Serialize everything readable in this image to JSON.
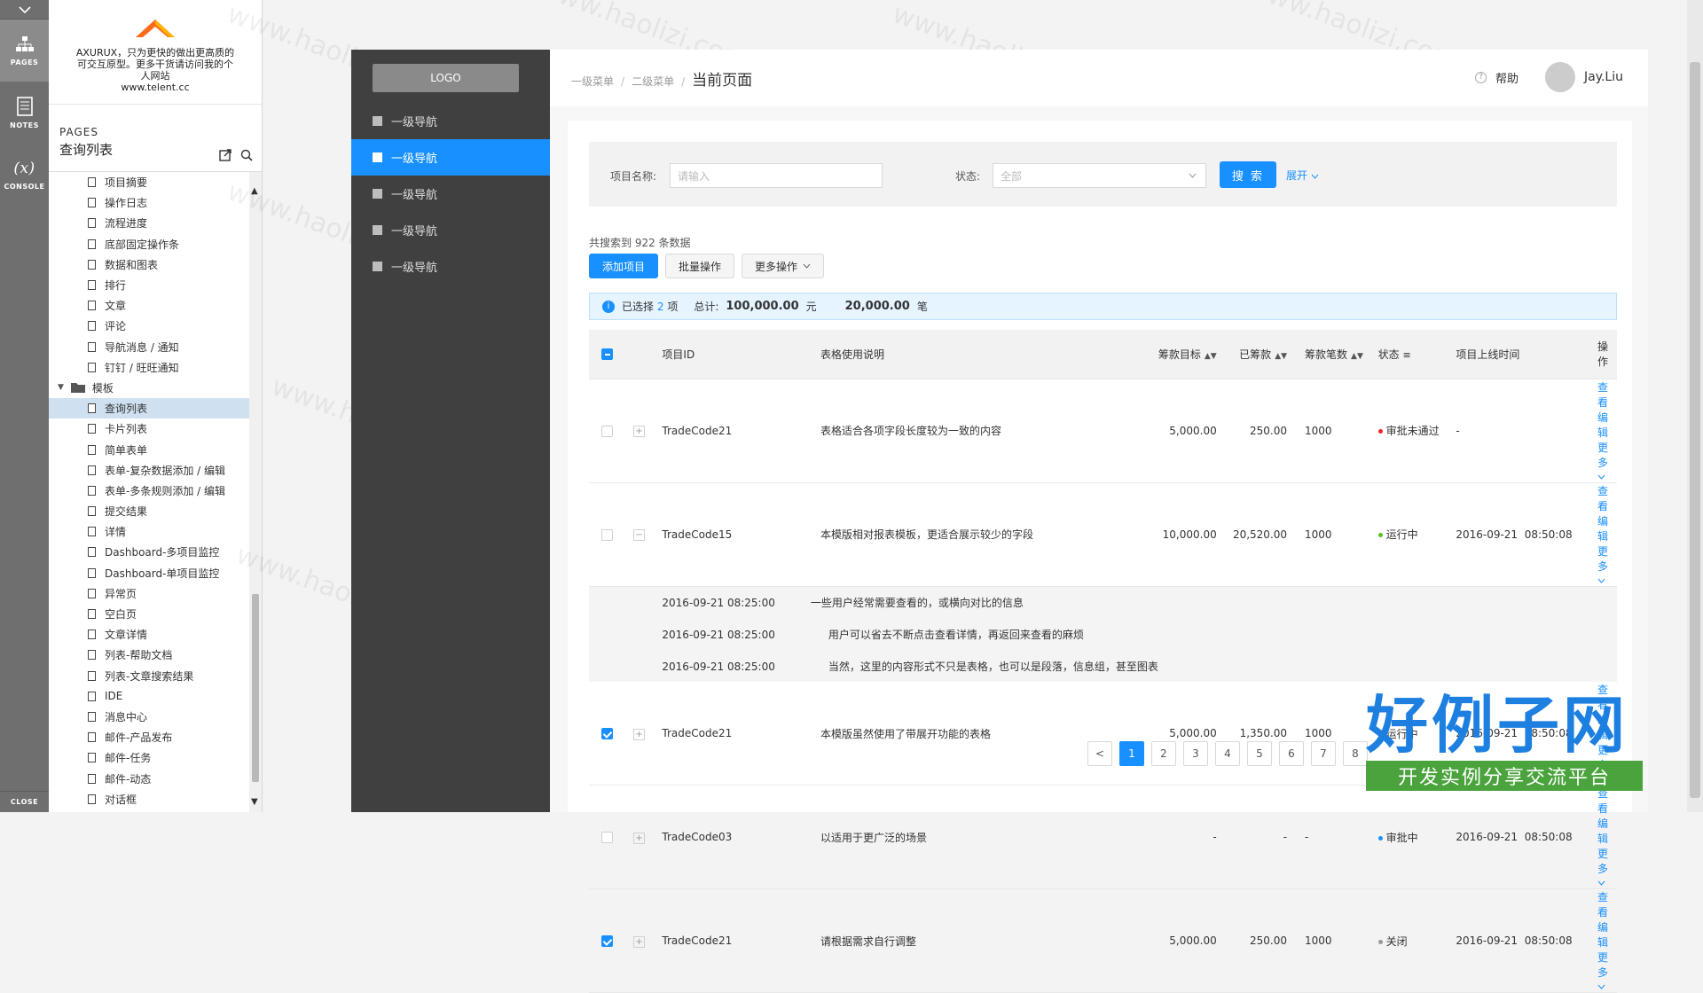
{
  "rail": {
    "tools": [
      {
        "label": "PAGES",
        "icon": "sitemap-icon"
      },
      {
        "label": "NOTES",
        "icon": "notes-icon"
      },
      {
        "label": "CONSOLE",
        "icon": "console-icon",
        "glyph": "(x)"
      }
    ],
    "close_label": "CLOSE"
  },
  "brand": {
    "line1": "AXURUX，只为更快的做出更高质的",
    "line2": "可交互原型。更多干货请访问我的个",
    "line3": "人网站",
    "line4": "www.telent.cc"
  },
  "pages_panel": {
    "caption": "PAGES",
    "current": "查询列表",
    "tree": [
      {
        "label": "项目摘要",
        "type": "page"
      },
      {
        "label": "操作日志",
        "type": "page"
      },
      {
        "label": "流程进度",
        "type": "page"
      },
      {
        "label": "底部固定操作条",
        "type": "page"
      },
      {
        "label": "数据和图表",
        "type": "page"
      },
      {
        "label": "排行",
        "type": "page"
      },
      {
        "label": "文章",
        "type": "page"
      },
      {
        "label": "评论",
        "type": "page"
      },
      {
        "label": "导航消息 / 通知",
        "type": "page"
      },
      {
        "label": "钉钉 / 旺旺通知",
        "type": "page"
      },
      {
        "label": "模板",
        "type": "folder"
      },
      {
        "label": "查询列表",
        "type": "page",
        "selected": true
      },
      {
        "label": "卡片列表",
        "type": "page"
      },
      {
        "label": "简单表单",
        "type": "page"
      },
      {
        "label": "表单-复杂数据添加 / 编辑",
        "type": "page"
      },
      {
        "label": "表单-多条规则添加 / 编辑",
        "type": "page"
      },
      {
        "label": "提交结果",
        "type": "page"
      },
      {
        "label": "详情",
        "type": "page"
      },
      {
        "label": "Dashboard-多项目监控",
        "type": "page"
      },
      {
        "label": "Dashboard-单项目监控",
        "type": "page"
      },
      {
        "label": "异常页",
        "type": "page"
      },
      {
        "label": "空白页",
        "type": "page"
      },
      {
        "label": "文章详情",
        "type": "page"
      },
      {
        "label": "列表-帮助文档",
        "type": "page"
      },
      {
        "label": "列表-文章搜索结果",
        "type": "page"
      },
      {
        "label": "IDE",
        "type": "page"
      },
      {
        "label": "消息中心",
        "type": "page"
      },
      {
        "label": "邮件-产品发布",
        "type": "page"
      },
      {
        "label": "邮件-任务",
        "type": "page"
      },
      {
        "label": "邮件-动态",
        "type": "page"
      },
      {
        "label": "对话框",
        "type": "page"
      }
    ]
  },
  "sidenav": {
    "logo": "LOGO",
    "items": [
      {
        "label": "一级导航",
        "active": false
      },
      {
        "label": "一级导航",
        "active": true
      },
      {
        "label": "一级导航",
        "active": false
      },
      {
        "label": "一级导航",
        "active": false
      },
      {
        "label": "一级导航",
        "active": false
      }
    ]
  },
  "topbar": {
    "crumb1": "一级菜单",
    "crumb2": "二级菜单",
    "crumb_sep": "/",
    "current": "当前页面",
    "help": "帮助",
    "help_glyph": "?",
    "user": "Jay.Liu"
  },
  "filter": {
    "name_label": "项目名称:",
    "name_placeholder": "请输入",
    "status_label": "状态:",
    "status_value": "全部",
    "search": "搜 索",
    "expand": "展开"
  },
  "list": {
    "total_text": "共搜索到 922 条数据",
    "add": "添加项目",
    "batch": "批量操作",
    "more_ops": "更多操作",
    "alert_selected_pre": "已选择",
    "alert_selected_count": "2",
    "alert_selected_post": "项",
    "alert_total_label": "总计:",
    "alert_total_amount": "100,000.00",
    "alert_total_unit": "元",
    "alert_count_amount": "20,000.00",
    "alert_count_unit": "笔",
    "info_glyph": "i"
  },
  "table": {
    "headers": {
      "id": "项目ID",
      "desc": "表格使用说明",
      "target": "筹款目标",
      "raised": "已筹款",
      "count": "筹款笔数",
      "status": "状态",
      "online": "项目上线时间",
      "ops": "操作"
    },
    "ops": {
      "view": "查看",
      "edit": "编辑",
      "more": "更多"
    },
    "rows": [
      {
        "checked": false,
        "expanded": false,
        "id": "TradeCode21",
        "desc": "表格适合各项字段长度较为一致的内容",
        "target": "5,000.00",
        "raised": "250.00",
        "count": "1000",
        "status": "审批未通过",
        "status_color": "#f5222d",
        "online": "-"
      },
      {
        "checked": false,
        "expanded": true,
        "id": "TradeCode15",
        "desc": "本模版相对报表模板，更适合展示较少的字段",
        "target": "10,000.00",
        "raised": "20,520.00",
        "count": "1000",
        "status": "运行中",
        "status_color": "#52c41a",
        "online": "2016-09-21  08:50:08",
        "details": [
          {
            "time": "2016-09-21 08:25:00",
            "text": "一些用户经常需要查看的，或横向对比的信息"
          },
          {
            "time": "2016-09-21 08:25:00",
            "text": "用户可以省去不断点击查看详情，再返回来查看的麻烦"
          },
          {
            "time": "2016-09-21 08:25:00",
            "text": "当然，这里的内容形式不只是表格，也可以是段落，信息组，甚至图表"
          }
        ]
      },
      {
        "checked": true,
        "expanded": false,
        "id": "TradeCode21",
        "desc": "本模版虽然使用了带展开功能的表格",
        "target": "5,000.00",
        "raised": "1,350.00",
        "count": "1000",
        "status": "运行中",
        "status_color": "#52c41a",
        "online": "2016-09-21  08:50:08"
      },
      {
        "checked": false,
        "expanded": false,
        "id": "TradeCode03",
        "desc": "以适用于更广泛的场景",
        "target": "-",
        "raised": "-",
        "count": "-",
        "status": "审批中",
        "status_color": "#1890ff",
        "online": "2016-09-21  08:50:08"
      },
      {
        "checked": true,
        "expanded": false,
        "id": "TradeCode21",
        "desc": "请根据需求自行调整",
        "target": "5,000.00",
        "raised": "250.00",
        "count": "1000",
        "status": "关闭",
        "status_color": "#999999",
        "online": "2016-09-21  08:50:08"
      }
    ]
  },
  "pager": {
    "prev": "<",
    "pages": [
      "1",
      "2",
      "3",
      "4",
      "5",
      "6",
      "7",
      "8"
    ],
    "current": "1"
  },
  "watermark": {
    "text": "www.haolizi.com",
    "big1": "好例子网",
    "big2": "开发实例分享交流平台"
  },
  "colors": {
    "primary": "#1890ff",
    "sidenav": "#404040",
    "rail": "#6f6f70"
  }
}
